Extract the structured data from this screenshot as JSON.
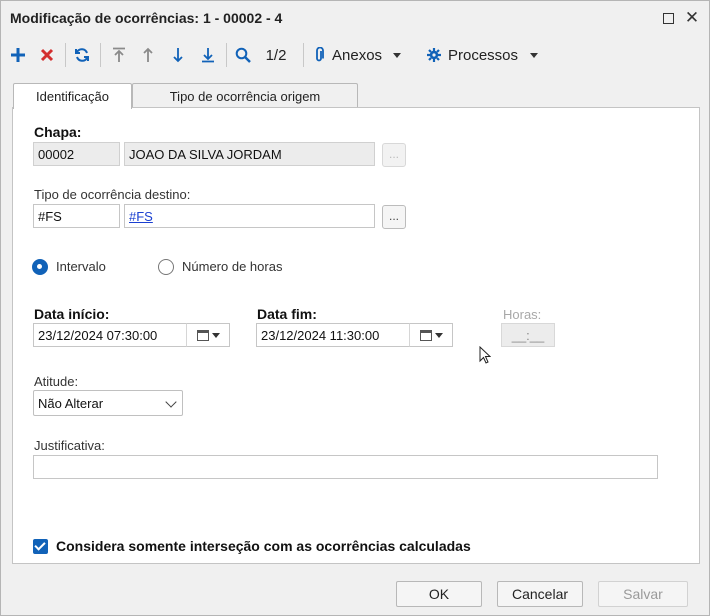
{
  "window": {
    "title": "Modificação de ocorrências: 1 - 00002 - 4"
  },
  "toolbar": {
    "record_position": "1/2",
    "attachments_label": "Anexos",
    "processes_label": "Processos"
  },
  "tabs": [
    {
      "label": "Identificação",
      "active": true
    },
    {
      "label": "Tipo de ocorrência origem",
      "active": false
    }
  ],
  "form": {
    "chapa_label": "Chapa:",
    "chapa_code": "00002",
    "chapa_name": "JOAO DA SILVA JORDAM",
    "lookup_label": "...",
    "tipo_label": "Tipo de ocorrência destino:",
    "tipo_code": "#FS",
    "tipo_link": "#FS",
    "radio_interval": "Intervalo",
    "radio_hours": "Número de horas",
    "selected_radio": "Intervalo",
    "data_inicio_label": "Data início:",
    "data_inicio_value": "23/12/2024 07:30:00",
    "data_fim_label": "Data fim:",
    "data_fim_value": "23/12/2024 11:30:00",
    "horas_label": "Horas:",
    "horas_value": "__:__",
    "atitude_label": "Atitude:",
    "atitude_value": "Não Alterar",
    "justificativa_label": "Justificativa:",
    "justificativa_value": "",
    "checkbox_label": "Considera somente interseção com as ocorrências calculadas",
    "checkbox_checked": true
  },
  "buttons": {
    "ok": "OK",
    "cancel": "Cancelar",
    "save": "Salvar"
  },
  "colors": {
    "accent": "#1162b8",
    "delete": "#d32f2f",
    "link": "#1a3fd1"
  }
}
